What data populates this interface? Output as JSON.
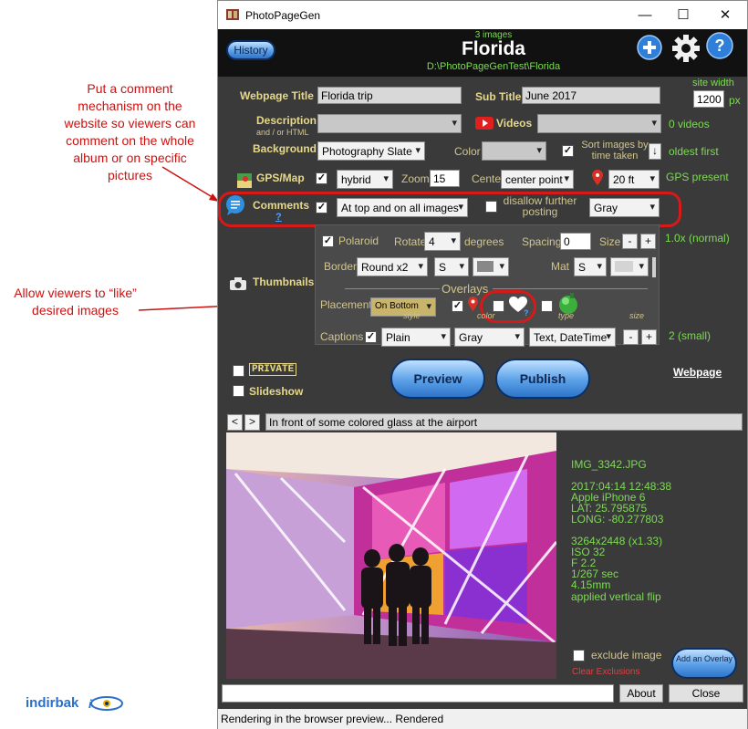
{
  "annotations": {
    "comment_note": "Put a comment mechanism on the website so viewers can comment on the whole album or on specific pictures",
    "like_note": "Allow viewers to “like” desired images"
  },
  "brand": {
    "name": "indirbak"
  },
  "window": {
    "title": "PhotoPageGen",
    "minimize": "—",
    "maximize": "☐",
    "close": "✕"
  },
  "header": {
    "history_button": "History",
    "image_count": "3 images",
    "album_title": "Florida",
    "path": "D:\\PhotoPageGenTest\\Florida",
    "add_icon": "plus-icon",
    "settings_icon": "gear-icon",
    "help_icon": "help-icon"
  },
  "form": {
    "webpage_title_label": "Webpage Title",
    "webpage_title_value": "Florida trip",
    "sub_title_label": "Sub Title",
    "sub_title_value": "June 2017",
    "site_width_label": "site width",
    "site_width_value": "1200",
    "site_width_unit": "px",
    "description_label": "Description",
    "description_sublabel": "and / or HTML",
    "description_value": "",
    "videos_label": "Videos",
    "videos_value": "",
    "videos_count": "0 videos",
    "background_label": "Background",
    "background_value": "Photography Slate",
    "color_label": "Color",
    "color_value": "",
    "sort_label": "Sort images by time taken",
    "sort_arrow": "↓",
    "sort_order": "oldest first",
    "gps_label": "GPS/Map",
    "map_type": "hybrid",
    "zoom_label": "Zoom",
    "zoom_value": "15",
    "center_label": "Center",
    "center_value": "center point",
    "radius_value": "20 ft",
    "gps_status": "GPS present",
    "comments_label": "Comments",
    "comments_help": "?",
    "comments_mode": "At top and on all images",
    "disallow_label": "disallow further posting",
    "comments_color": "Gray"
  },
  "thumbnails": {
    "label": "Thumbnails",
    "polaroid_label": "Polaroid",
    "rotate_label": "Rotate",
    "rotate_value": "4",
    "degrees_label": "degrees",
    "spacing_label": "Spacing",
    "spacing_value": "0",
    "size_label": "Size",
    "size_minus": "-",
    "size_plus": "+",
    "size_value": "1.0x (normal)",
    "border_label": "Border",
    "border_value": "Round x2",
    "border_size": "S",
    "mat_label": "Mat",
    "mat_size": "S",
    "overlays_label": "Overlays",
    "placement_label": "Placement",
    "placement_value": "On Bottom",
    "like_help": "?",
    "captions_label": "Captions",
    "caption_style": "Plain",
    "caption_color": "Gray",
    "caption_type": "Text, DateTime",
    "style_label": "style",
    "color_label": "color",
    "type_label": "type",
    "size_label2": "size",
    "caption_minus": "-",
    "caption_plus": "+",
    "caption_size_value": "2 (small)"
  },
  "publish": {
    "private_label": "PRIVATE",
    "slideshow_label": "Slideshow",
    "preview_button": "Preview",
    "publish_button": "Publish",
    "webpage_link": "Webpage"
  },
  "viewer": {
    "prev": "<",
    "next": ">",
    "caption": "In front of some colored glass at the airport",
    "file_name": "IMG_3342.JPG",
    "date": "2017:04:14 12:48:38",
    "camera": "Apple iPhone 6",
    "lat": "LAT: 25.795875",
    "long": "LONG: -80.277803",
    "dimensions": "3264x2448 (x1.33)",
    "iso": "ISO 32",
    "aperture": "F 2.2",
    "shutter": "1/267 sec",
    "focal": "4.15mm",
    "note": "applied vertical flip",
    "exclude_label": "exclude image",
    "clear_exclusions": "Clear Exclusions",
    "add_overlay_button": "Add an Overlay"
  },
  "bottom": {
    "input_value": "",
    "about_button": "About",
    "close_button": "Close",
    "status": "Rendering in the browser preview... Rendered"
  },
  "colors": {
    "label_yellow": "#e6d98a",
    "value_green": "#7ed957",
    "annotation_red": "#cc1111",
    "dark_bg": "#3a3a3a"
  }
}
